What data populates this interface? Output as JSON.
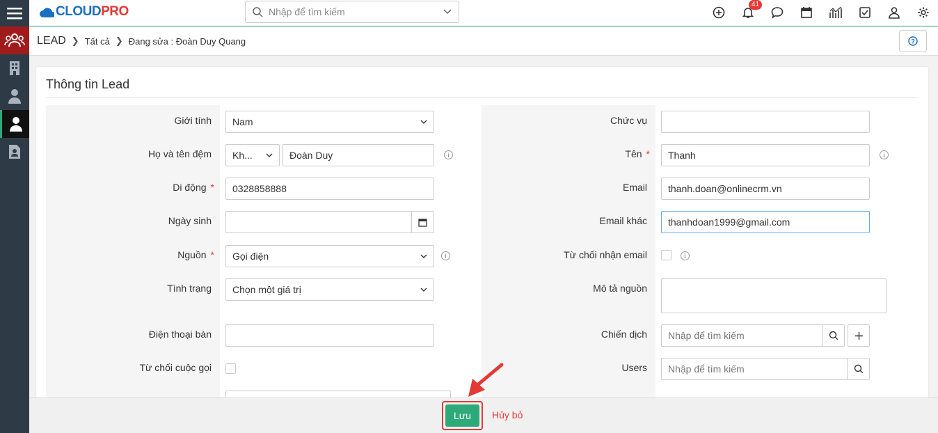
{
  "topbar": {
    "logo_text_cloud": "CLOUD",
    "logo_text_pro": "PRO",
    "search_placeholder": "Nhập để tìm kiếm",
    "notification_count": "41",
    "icons": [
      "plus-circle-icon",
      "bell-icon",
      "chat-icon",
      "calendar-icon",
      "analytics-icon",
      "task-icon",
      "user-icon",
      "gear-icon"
    ]
  },
  "sidebar": {
    "items": [
      "menu-icon",
      "contacts-group-icon",
      "building-icon",
      "contact-icon",
      "lead-icon",
      "document-user-icon"
    ]
  },
  "breadcrumb": {
    "root": "LEAD",
    "level1": "Tất cả",
    "current": "Đang sửa : Đoàn Duy Quang"
  },
  "form": {
    "title": "Thông tin Lead",
    "left": {
      "gender_label": "Giới tính",
      "gender_value": "Nam",
      "lastname_label": "Họ và tên đệm",
      "salutation_value": "Kh...",
      "lastname_value": "Đoàn Duy",
      "mobile_label": "Di động",
      "mobile_value": "0328858888",
      "birthday_label": "Ngày sinh",
      "birthday_value": "",
      "source_label": "Nguồn",
      "source_value": "Gọi điện",
      "status_label": "Tình trạng",
      "status_value": "Chọn một giá trị",
      "phone_label": "Điện thoại bàn",
      "phone_value": "",
      "decline_call_label": "Từ chối cuộc gọi"
    },
    "right": {
      "position_label": "Chức vụ",
      "position_value": "",
      "firstname_label": "Tên",
      "firstname_value": "Thanh",
      "email_label": "Email",
      "email_value": "thanh.doan@onlinecrm.vn",
      "email2_label": "Email khác",
      "email2_value": "thanhdoan1999@gmail.com",
      "decline_email_label": "Từ chối nhận email",
      "source_desc_label": "Mô tả nguồn",
      "campaign_label": "Chiến dịch",
      "campaign_placeholder": "Nhập để tìm kiếm",
      "users_label": "Users",
      "users_placeholder": "Nhập để tìm kiếm"
    }
  },
  "footer": {
    "save_label": "Lưu",
    "cancel_label": "Hủy bỏ"
  },
  "colors": {
    "accent": "#2eaa7a",
    "highlight": "#e53935",
    "sidebar": "#2e3a46"
  }
}
